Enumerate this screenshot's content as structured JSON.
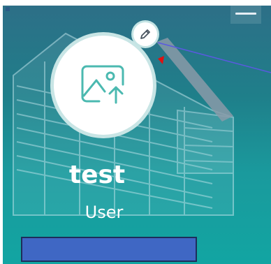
{
  "profile": {
    "name": "test",
    "role": "User"
  },
  "icons": {
    "avatar_placeholder": "image-upload-icon",
    "edit": "pencil-icon",
    "menu": "hamburger-menu-icon"
  },
  "colors": {
    "background_top": "#2d6f87",
    "background_bottom": "#12a5a2",
    "action_bar": "#3f67c4",
    "avatar_ring": "#bee1e1",
    "icon_teal": "#4bb9b0"
  }
}
